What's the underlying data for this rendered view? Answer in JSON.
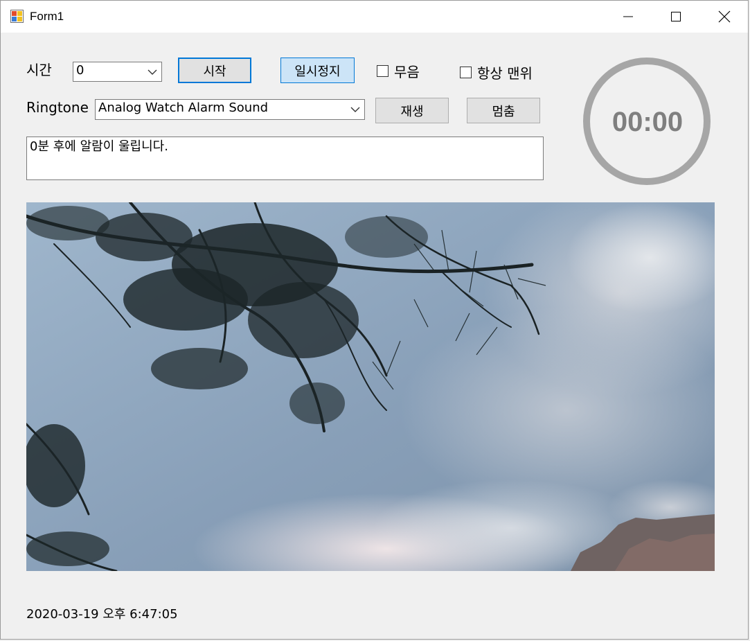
{
  "window": {
    "title": "Form1",
    "icon": "app-form-icon",
    "caption_buttons": [
      "minimize-icon",
      "maximize-icon",
      "close-icon"
    ]
  },
  "controls": {
    "time_label": "시간",
    "time_value": "0",
    "start_button": "시작",
    "pause_button": "일시정지",
    "mute_label": "무음",
    "mute_checked": false,
    "topmost_label": "항상 맨위",
    "topmost_checked": false,
    "ringtone_label": "Ringtone",
    "ringtone_value": "Analog Watch Alarm Sound",
    "play_button": "재생",
    "stop_button": "멈춤",
    "message": "0분 후에 알람이 울립니다."
  },
  "timer": {
    "display": "00:00",
    "ring_color": "#a6a6a6",
    "text_color": "#7f7f7f"
  },
  "picture": {
    "description_icon": "landscape-photo",
    "sky_color": "#8ea5bd",
    "cloud_color": "#d8dde4",
    "branch_color": "#1a2224",
    "rock_color": "#6b5e5c"
  },
  "status": {
    "datetime": "2020-03-19 오후 6:47:05"
  },
  "colors": {
    "accent": "#0078d7",
    "button_bg": "#e1e1e1",
    "button_hot_bg": "#cce4f7",
    "form_bg": "#f0f0f0"
  }
}
